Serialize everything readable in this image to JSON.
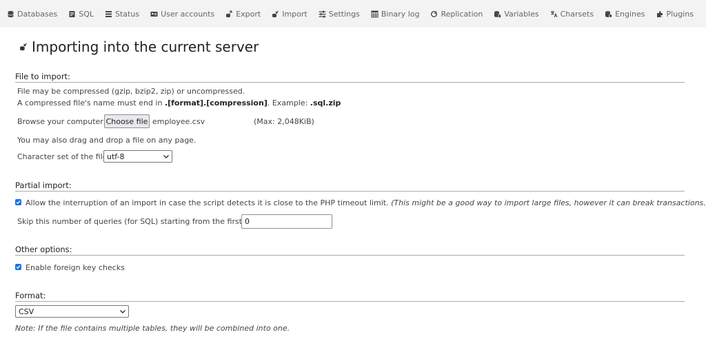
{
  "nav": {
    "tabs": [
      {
        "label": "Databases",
        "icon": "database-icon"
      },
      {
        "label": "SQL",
        "icon": "sql-icon"
      },
      {
        "label": "Status",
        "icon": "status-icon"
      },
      {
        "label": "User accounts",
        "icon": "user-accounts-icon"
      },
      {
        "label": "Export",
        "icon": "export-icon"
      },
      {
        "label": "Import",
        "icon": "import-icon"
      },
      {
        "label": "Settings",
        "icon": "settings-icon"
      },
      {
        "label": "Binary log",
        "icon": "binary-log-icon"
      },
      {
        "label": "Replication",
        "icon": "replication-icon"
      },
      {
        "label": "Variables",
        "icon": "variables-icon"
      },
      {
        "label": "Charsets",
        "icon": "charsets-icon"
      },
      {
        "label": "Engines",
        "icon": "engines-icon"
      },
      {
        "label": "Plugins",
        "icon": "plugins-icon"
      }
    ]
  },
  "page": {
    "title": "Importing into the current server"
  },
  "file_section": {
    "heading": "File to import:",
    "compress_note": "File may be compressed (gzip, bzip2, zip) or uncompressed.",
    "name_note_prefix": "A compressed file's name must end in ",
    "name_note_format": ".[format].[compression]",
    "name_note_example": ". Example: ",
    "name_note_example_value": ".sql.zip",
    "browse_label": "Browse your computer:",
    "choose_button": "Choose file",
    "file_name": "employee.csv",
    "max_size": "(Max: 2,048KiB)",
    "drag_drop_note": "You may also drag and drop a file on any page.",
    "charset_label": "Character set of the file:",
    "charset_value": "utf-8"
  },
  "partial_section": {
    "heading": "Partial import:",
    "allow_interrupt_label": "Allow the interruption of an import in case the script detects it is close to the PHP timeout limit.",
    "allow_interrupt_note": "(This might be a good way to import large files, however it can break transactions.)",
    "allow_interrupt_checked": true,
    "skip_label": "Skip this number of queries (for SQL) starting from the first one:",
    "skip_value": "0"
  },
  "other_section": {
    "heading": "Other options:",
    "fk_label": "Enable foreign key checks",
    "fk_checked": true
  },
  "format_section": {
    "heading": "Format:",
    "format_value": "CSV",
    "note": "Note: If the file contains multiple tables, they will be combined into one."
  },
  "colors": {
    "nav_bg": "#f3f3f3",
    "checkbox": "#1a73e8"
  }
}
